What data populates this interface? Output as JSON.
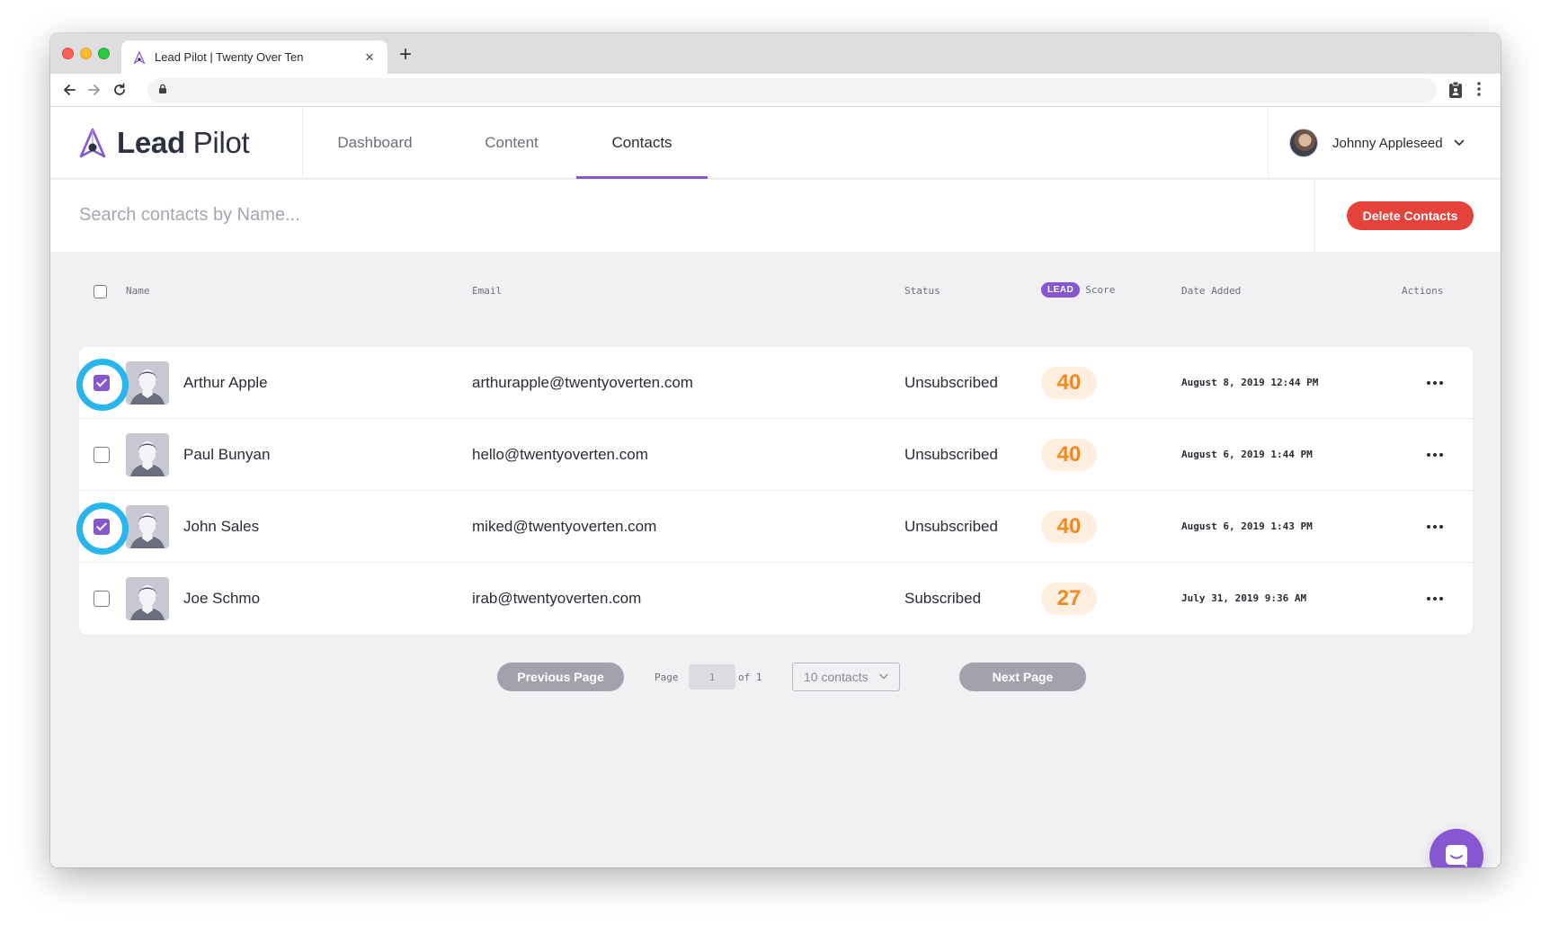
{
  "browser": {
    "tab_title": "Lead Pilot | Twenty Over Ten",
    "tab_close": "×",
    "new_tab": "+",
    "url": ""
  },
  "app": {
    "logo": {
      "bold": "Lead",
      "light": "Pilot"
    },
    "nav": [
      {
        "label": "Dashboard",
        "active": false
      },
      {
        "label": "Content",
        "active": false
      },
      {
        "label": "Contacts",
        "active": true
      }
    ],
    "user": {
      "name": "Johnny Appleseed"
    },
    "colors": {
      "accent": "#8756d1",
      "danger": "#e5423b",
      "score": "#f08a24",
      "highlight": "#28b6ec"
    }
  },
  "search": {
    "placeholder": "Search contacts by Name...",
    "value": ""
  },
  "delete_button": "Delete Contacts",
  "table": {
    "headers": {
      "name": "Name",
      "email": "Email",
      "status": "Status",
      "lead_badge": "LEAD",
      "score": "Score",
      "date_added": "Date Added",
      "actions": "Actions"
    },
    "rows": [
      {
        "name": "Arthur Apple",
        "email": "arthurapple@twentyoverten.com",
        "status": "Unsubscribed",
        "score": "40",
        "date": "August 8, 2019 12:44 PM",
        "checked": true
      },
      {
        "name": "Paul Bunyan",
        "email": "hello@twentyoverten.com",
        "status": "Unsubscribed",
        "score": "40",
        "date": "August 6, 2019 1:44 PM",
        "checked": false
      },
      {
        "name": "John Sales",
        "email": "miked@twentyoverten.com",
        "status": "Unsubscribed",
        "score": "40",
        "date": "August 6, 2019 1:43 PM",
        "checked": true
      },
      {
        "name": "Joe Schmo",
        "email": "irab@twentyoverten.com",
        "status": "Subscribed",
        "score": "27",
        "date": "July 31, 2019 9:36 AM",
        "checked": false
      }
    ]
  },
  "pagination": {
    "previous": "Previous Page",
    "page_label": "Page",
    "current_page": "1",
    "of_label": "of 1",
    "per_page": "10 contacts",
    "next": "Next Page"
  },
  "icons": {
    "favicon": "lead-pilot-logo-icon",
    "back": "arrow-left-icon",
    "forward": "arrow-right-icon",
    "reload": "reload-icon",
    "lock": "lock-icon",
    "extension": "clipboard-icon",
    "menu": "kebab-menu-icon",
    "user_dropdown": "chevron-down-icon",
    "row_actions": "ellipsis-icon",
    "chat": "chat-bubble-icon"
  }
}
